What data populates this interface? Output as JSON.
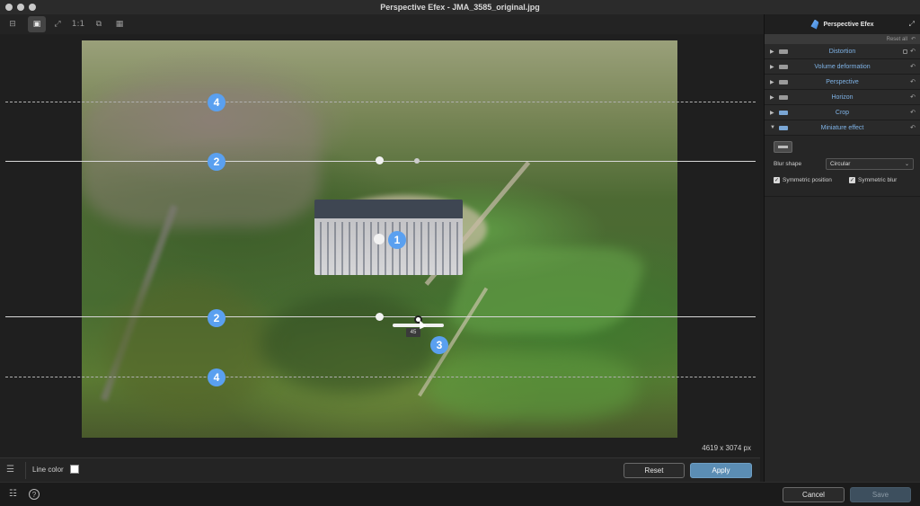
{
  "window": {
    "title": "Perspective Efex - JMA_3585_original.jpg"
  },
  "toolbar": {
    "tools": [
      {
        "name": "compare-split-icon",
        "glyph": "⊟"
      },
      {
        "name": "image-view-icon",
        "glyph": "▣"
      },
      {
        "name": "fit-screen-icon",
        "glyph": "⤢"
      },
      {
        "name": "one-to-one-icon",
        "glyph": "1:1"
      },
      {
        "name": "layers-icon",
        "glyph": "⧉"
      },
      {
        "name": "grid-icon",
        "glyph": "▦"
      }
    ]
  },
  "canvas": {
    "badges": [
      "4",
      "2",
      "1",
      "2",
      "3",
      "4"
    ],
    "slider_value": "45",
    "dimensions": "4619 x 3074 px"
  },
  "bottombar": {
    "line_color_label": "Line color",
    "line_color": "#ffffff",
    "reset_label": "Reset",
    "apply_label": "Apply"
  },
  "footer": {
    "cancel_label": "Cancel",
    "save_label": "Save"
  },
  "panel": {
    "title": "Perspective Efex",
    "reset_all": "Reset all",
    "sections": [
      {
        "label": "Distortion",
        "expanded": false
      },
      {
        "label": "Volume deformation",
        "expanded": false
      },
      {
        "label": "Perspective",
        "expanded": false
      },
      {
        "label": "Horizon",
        "expanded": false
      },
      {
        "label": "Crop",
        "expanded": false
      },
      {
        "label": "Miniature effect",
        "expanded": true
      }
    ],
    "miniature": {
      "blur_shape_label": "Blur shape",
      "blur_shape_value": "Circular",
      "symmetric_position_label": "Symmetric position",
      "symmetric_blur_label": "Symmetric blur",
      "symmetric_position_checked": true,
      "symmetric_blur_checked": true
    }
  },
  "colors": {
    "accent": "#5aa0f0",
    "apply_button": "#5b8db4",
    "section_label": "#7fb3e6"
  }
}
